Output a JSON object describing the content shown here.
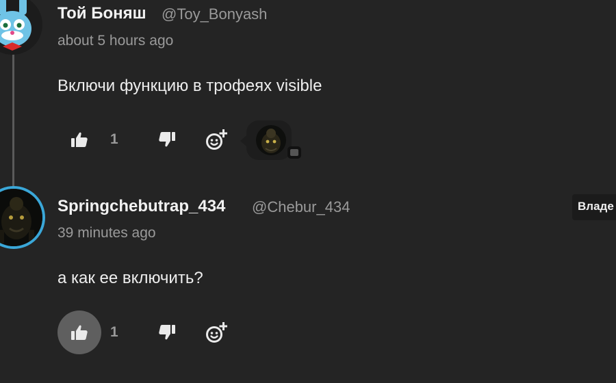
{
  "comments": [
    {
      "name": "Той Боняш",
      "handle": "@Toy_Bonyash",
      "time": "about 5 hours ago",
      "text": "Включи функцию в трофеях visible",
      "likes": "1",
      "liked": false,
      "avatar": "toy-bonnie-avatar"
    },
    {
      "name": "Springchebutrap_434",
      "handle": "@Chebur_434",
      "time": "39 minutes ago",
      "text": "а как ее включить?",
      "likes": "1",
      "liked": true,
      "avatar": "dark-animatronic-avatar",
      "badge": "Владе"
    }
  ],
  "icons": {
    "like": "thumbs-up-icon",
    "dislike": "thumbs-down-icon",
    "add_reaction": "add-reaction-icon",
    "reaction": "reaction-avatar-icon"
  },
  "colors": {
    "background": "#242424",
    "avatar_ring": "#3aa7d8",
    "muted_text": "#9a9a9a",
    "active_like_bg": "#5f5f5f"
  }
}
